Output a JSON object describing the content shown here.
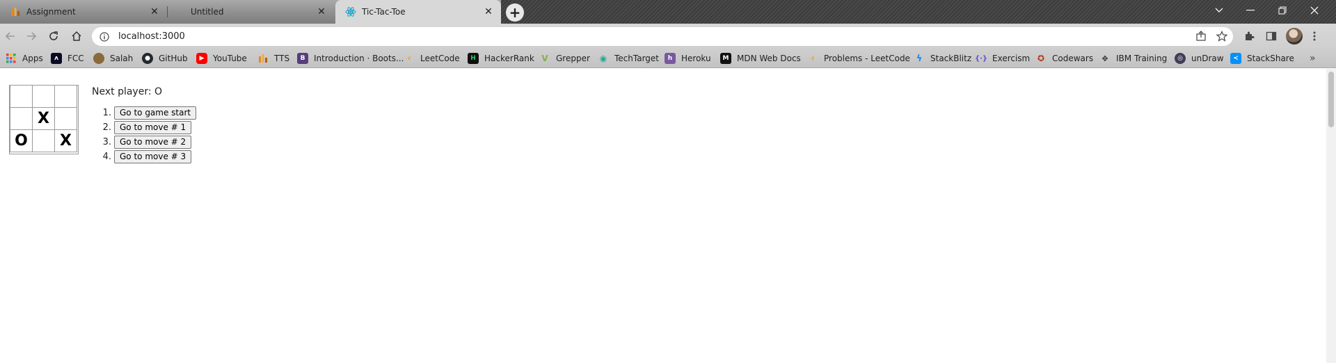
{
  "browser": {
    "tabs": [
      {
        "title": "Assignment",
        "favicon": "aws-academy-icon",
        "active": false
      },
      {
        "title": "Untitled",
        "favicon": "none",
        "active": false
      },
      {
        "title": "Tic-Tac-Toe",
        "favicon": "react-icon",
        "active": true
      }
    ],
    "address": "localhost:3000",
    "bookmarks": [
      {
        "label": "Apps",
        "icon": "apps-grid-icon",
        "color": "#e94235"
      },
      {
        "label": "FCC",
        "icon": "fcc-icon",
        "color": "#0a0a23"
      },
      {
        "label": "Salah",
        "icon": "salah-icon",
        "color": "#8a6a3a"
      },
      {
        "label": "GitHub",
        "icon": "github-icon",
        "color": "#24292e"
      },
      {
        "label": "YouTube",
        "icon": "youtube-icon",
        "color": "#ff0000"
      },
      {
        "label": "TTS",
        "icon": "tts-icon",
        "color": "#e8891c"
      },
      {
        "label": "Introduction · Boots...",
        "icon": "bootstrap-icon",
        "color": "#563d7c"
      },
      {
        "label": "LeetCode",
        "icon": "leetcode-icon",
        "color": "#f89f1b"
      },
      {
        "label": "HackerRank",
        "icon": "hackerrank-icon",
        "color": "#0f0f0f"
      },
      {
        "label": "Grepper",
        "icon": "grepper-icon",
        "color": "#7cb342"
      },
      {
        "label": "TechTarget",
        "icon": "techtarget-icon",
        "color": "#26a69a"
      },
      {
        "label": "Heroku",
        "icon": "heroku-icon",
        "color": "#79589f"
      },
      {
        "label": "MDN Web Docs",
        "icon": "mdn-icon",
        "color": "#111111"
      },
      {
        "label": "Problems - LeetCode",
        "icon": "leetcode-icon",
        "color": "#f89f1b"
      },
      {
        "label": "StackBlitz",
        "icon": "stackblitz-icon",
        "color": "#1389fd"
      },
      {
        "label": "Exercism",
        "icon": "exercism-icon",
        "color": "#604fcd"
      },
      {
        "label": "Codewars",
        "icon": "codewars-icon",
        "color": "#b1361e"
      },
      {
        "label": "IBM Training",
        "icon": "ibm-icon",
        "color": "#333333"
      },
      {
        "label": "unDraw",
        "icon": "undraw-icon",
        "color": "#3f3d56"
      },
      {
        "label": "StackShare",
        "icon": "stackshare-icon",
        "color": "#0690fa"
      }
    ]
  },
  "game": {
    "status": "Next player: O",
    "board": [
      "",
      "",
      "",
      "",
      "X",
      "",
      "O",
      "",
      "X"
    ],
    "moves": [
      {
        "num": "1.",
        "label": "Go to game start"
      },
      {
        "num": "2.",
        "label": "Go to move # 1"
      },
      {
        "num": "3.",
        "label": "Go to move # 2"
      },
      {
        "num": "4.",
        "label": "Go to move # 3"
      }
    ]
  }
}
